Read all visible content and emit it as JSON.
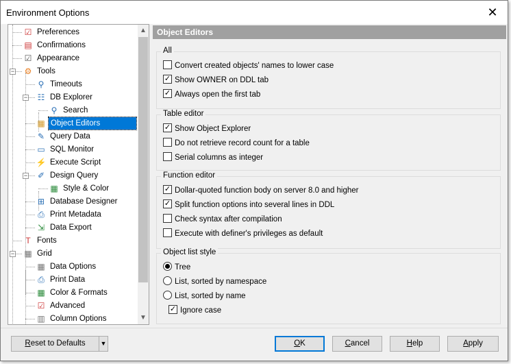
{
  "window": {
    "title": "Environment Options",
    "close_icon": "close-icon"
  },
  "tree": [
    {
      "label": "Preferences",
      "icon": "preferences-icon",
      "level": 0
    },
    {
      "label": "Confirmations",
      "icon": "confirmations-icon",
      "level": 0
    },
    {
      "label": "Appearance",
      "icon": "appearance-icon",
      "level": 0
    },
    {
      "label": "Tools",
      "icon": "gears-icon",
      "level": 0,
      "expanded": true
    },
    {
      "label": "Timeouts",
      "icon": "timeouts-icon",
      "level": 1
    },
    {
      "label": "DB Explorer",
      "icon": "tree-icon",
      "level": 1,
      "expanded": true
    },
    {
      "label": "Search",
      "icon": "search-icon",
      "level": 2
    },
    {
      "label": "Object Editors",
      "icon": "object-editors-icon",
      "level": 1,
      "selected": true
    },
    {
      "label": "Query Data",
      "icon": "query-data-icon",
      "level": 1
    },
    {
      "label": "SQL Monitor",
      "icon": "monitor-icon",
      "level": 1
    },
    {
      "label": "Execute Script",
      "icon": "execute-script-icon",
      "level": 1
    },
    {
      "label": "Design Query",
      "icon": "design-query-icon",
      "level": 1,
      "expanded": true
    },
    {
      "label": "Style & Color",
      "icon": "palette-icon",
      "level": 2
    },
    {
      "label": "Database Designer",
      "icon": "database-designer-icon",
      "level": 1
    },
    {
      "label": "Print Metadata",
      "icon": "printer-icon",
      "level": 1
    },
    {
      "label": "Data Export",
      "icon": "export-icon",
      "level": 1
    },
    {
      "label": "Fonts",
      "icon": "fonts-icon",
      "level": 0
    },
    {
      "label": "Grid",
      "icon": "grid-icon",
      "level": 0,
      "expanded": true
    },
    {
      "label": "Data Options",
      "icon": "grid-icon",
      "level": 1
    },
    {
      "label": "Print Data",
      "icon": "printer-icon",
      "level": 1
    },
    {
      "label": "Color & Formats",
      "icon": "palette-icon",
      "level": 1
    },
    {
      "label": "Advanced",
      "icon": "advanced-icon",
      "level": 1
    },
    {
      "label": "Column Options",
      "icon": "columns-icon",
      "level": 1
    }
  ],
  "panel": {
    "header": "Object Editors",
    "groups": [
      {
        "title": "All",
        "options": [
          {
            "label": "Convert created objects' names to lower case",
            "checked": false
          },
          {
            "label": "Show OWNER on DDL tab",
            "checked": true
          },
          {
            "label": "Always open the first tab",
            "checked": true
          }
        ]
      },
      {
        "title": "Table editor",
        "options": [
          {
            "label": "Show Object Explorer",
            "checked": true
          },
          {
            "label": "Do not retrieve record count for a table",
            "checked": false
          },
          {
            "label": "Serial columns as integer",
            "checked": false
          }
        ]
      },
      {
        "title": "Function editor",
        "options": [
          {
            "label": "Dollar-quoted function body on server 8.0 and higher",
            "checked": true
          },
          {
            "label": "Split function options into several lines in DDL",
            "checked": true
          },
          {
            "label": "Check syntax after compilation",
            "checked": false
          },
          {
            "label": "Execute with definer's privileges as default",
            "checked": false
          }
        ]
      }
    ],
    "list_style": {
      "title": "Object list style",
      "radios": [
        {
          "label": "Tree",
          "selected": true
        },
        {
          "label": "List, sorted by namespace",
          "selected": false
        },
        {
          "label": "List, sorted by name",
          "selected": false
        }
      ],
      "ignore_case": {
        "label": "Ignore case",
        "checked": true
      }
    }
  },
  "buttons": {
    "reset": {
      "key": "R",
      "rest": "eset to Defaults"
    },
    "ok": {
      "key": "O",
      "rest": "K"
    },
    "cancel": {
      "key": "C",
      "rest": "ancel"
    },
    "help": {
      "key": "H",
      "rest": "elp"
    },
    "apply": {
      "key": "A",
      "rest": "pply"
    }
  },
  "colors": {
    "selection": "#0078d7",
    "header": "#a0a0a0"
  }
}
